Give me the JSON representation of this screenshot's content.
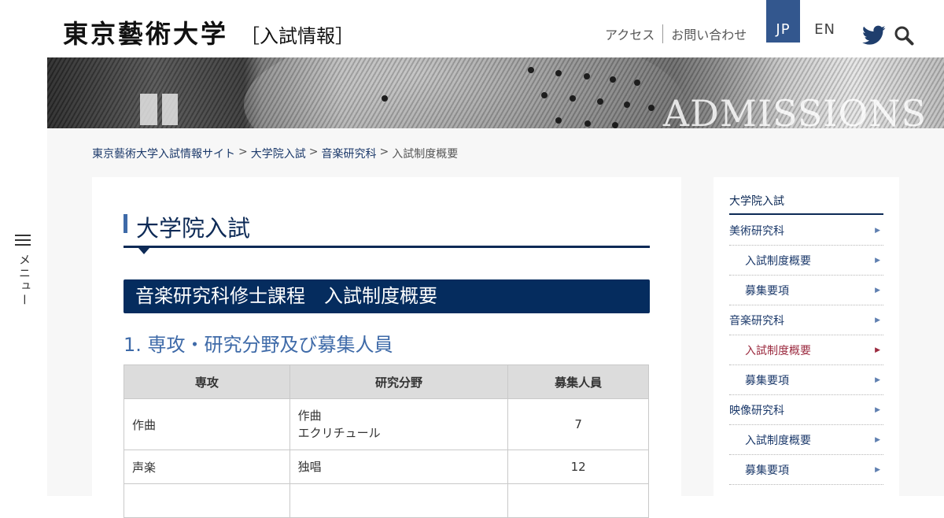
{
  "header": {
    "logo_main": "東京藝術大学",
    "logo_sub": "［入試情報］",
    "nav": {
      "access": "アクセス",
      "contact": "お問い合わせ"
    },
    "lang": {
      "jp": "JP",
      "en": "EN",
      "active": "JP"
    },
    "icons": {
      "twitter": "twitter-icon",
      "search": "search-icon"
    }
  },
  "hero": {
    "text": "ADMISSIONS"
  },
  "breadcrumb": {
    "items": [
      "東京藝術大学入試情報サイト",
      "大学院入試",
      "音楽研究科"
    ],
    "current": "入試制度概要",
    "separator": ">"
  },
  "menu": {
    "label": "メニュー"
  },
  "main": {
    "page_title": "大学院入試",
    "section_title": "音楽研究科修士課程　入試制度概要",
    "sub_title": "1. 専攻・研究分野及び募集人員",
    "table": {
      "headers": [
        "専攻",
        "研究分野",
        "募集人員"
      ],
      "rows": [
        {
          "major": "作曲",
          "fields": [
            "作曲",
            "エクリチュール"
          ],
          "count": "7"
        },
        {
          "major": "声楽",
          "fields": [
            "独唱"
          ],
          "count": "12"
        }
      ]
    }
  },
  "sidebar": {
    "top": "大学院入試",
    "items": [
      {
        "label": "美術研究科"
      },
      {
        "label": "入試制度概要"
      },
      {
        "label": "募集要項"
      },
      {
        "label": "音楽研究科"
      },
      {
        "label": "入試制度概要"
      },
      {
        "label": "募集要項"
      },
      {
        "label": "映像研究科"
      },
      {
        "label": "入試制度概要"
      },
      {
        "label": "募集要項"
      }
    ]
  },
  "colors": {
    "navy": "#052c5e",
    "accent_blue": "#3e6aa8",
    "active_red": "#9b2a3f",
    "lang_active_bg": "#33578e"
  }
}
